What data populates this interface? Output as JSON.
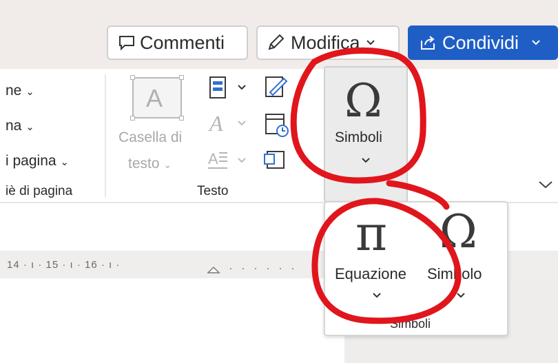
{
  "header": {
    "comments_label": "Commenti",
    "edit_label": "Modifica",
    "share_label": "Condividi"
  },
  "ribbon": {
    "header_footer_items": [
      "ne",
      "na",
      "i pagina"
    ],
    "header_footer_group_label": "iè di pagina",
    "textbox_label_line1": "Casella di",
    "textbox_label_line2": "testo",
    "text_group_label": "Testo",
    "symbols_button_label": "Simboli"
  },
  "ruler": {
    "marks": "14 · ı · 15 · ı · 16 · ı ·"
  },
  "dropdown": {
    "equation_label": "Equazione",
    "symbol_label": "Simbolo",
    "group_label": "Simboli"
  },
  "colors": {
    "share_button": "#1f5fc5",
    "annotation_red": "#e0161c",
    "topbar_bg": "#f1ecea"
  }
}
